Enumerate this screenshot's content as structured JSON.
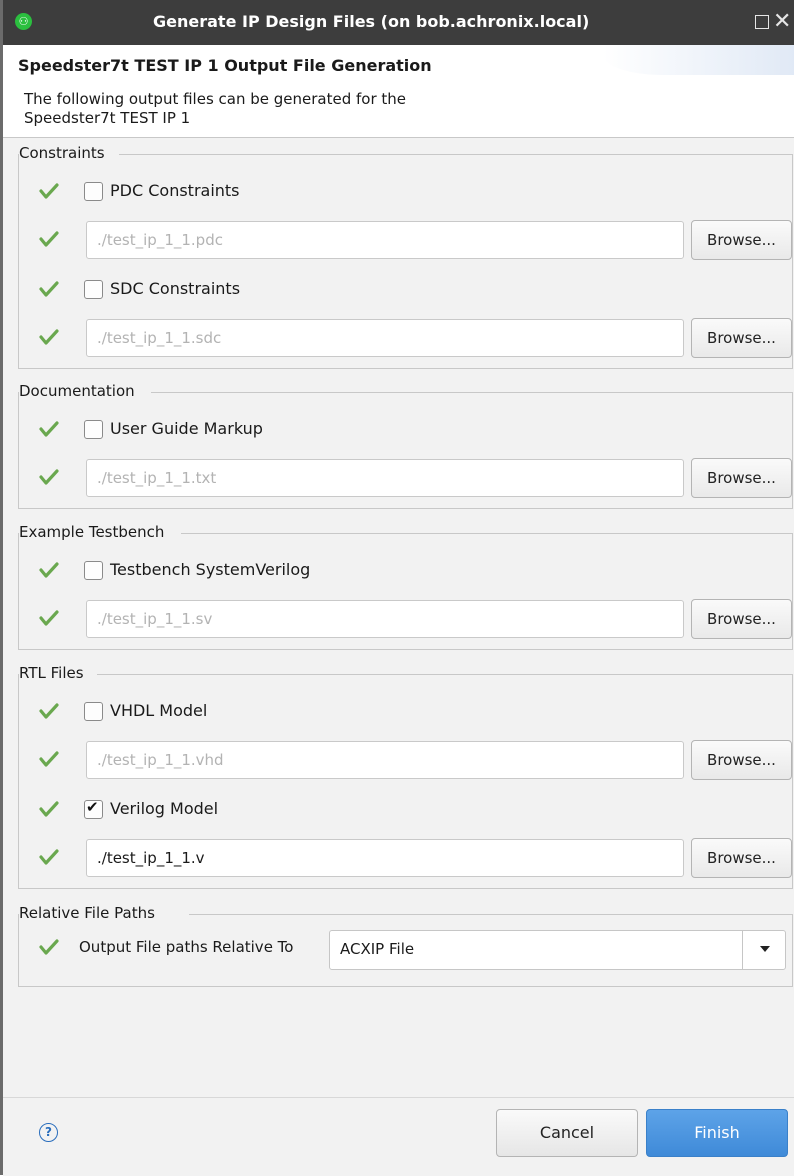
{
  "window": {
    "title": "Generate IP Design Files  (on bob.achronix.local)"
  },
  "header": {
    "heading": "Speedster7t TEST IP 1 Output File Generation",
    "description_line1": "The following output files can be generated for the",
    "description_line2": "Speedster7t TEST IP 1"
  },
  "colors": {
    "accent": "#3f8ad8",
    "check": "#6aa84f",
    "titlebar": "#3d3d3d",
    "panel": "#f2f2f2"
  },
  "groups": {
    "constraints": {
      "label": "Constraints",
      "pdc": {
        "label": "PDC Constraints",
        "checked": false,
        "path": "./test_ip_1_1.pdc"
      },
      "sdc": {
        "label": "SDC Constraints",
        "checked": false,
        "path": "./test_ip_1_1.sdc"
      }
    },
    "documentation": {
      "label": "Documentation",
      "guide": {
        "label": "User Guide Markup",
        "checked": false,
        "path": "./test_ip_1_1.txt"
      }
    },
    "testbench": {
      "label": "Example Testbench",
      "sv": {
        "label": "Testbench SystemVerilog",
        "checked": false,
        "path": "./test_ip_1_1.sv"
      }
    },
    "rtl": {
      "label": "RTL Files",
      "vhdl": {
        "label": "VHDL Model",
        "checked": false,
        "path": "./test_ip_1_1.vhd"
      },
      "verilog": {
        "label": "Verilog Model",
        "checked": true,
        "path": "./test_ip_1_1.v"
      }
    },
    "relative": {
      "label": "Relative File Paths",
      "option_label": "Output File paths Relative To",
      "selected": "ACXIP File"
    }
  },
  "buttons": {
    "browse": "Browse...",
    "cancel": "Cancel",
    "finish": "Finish"
  }
}
